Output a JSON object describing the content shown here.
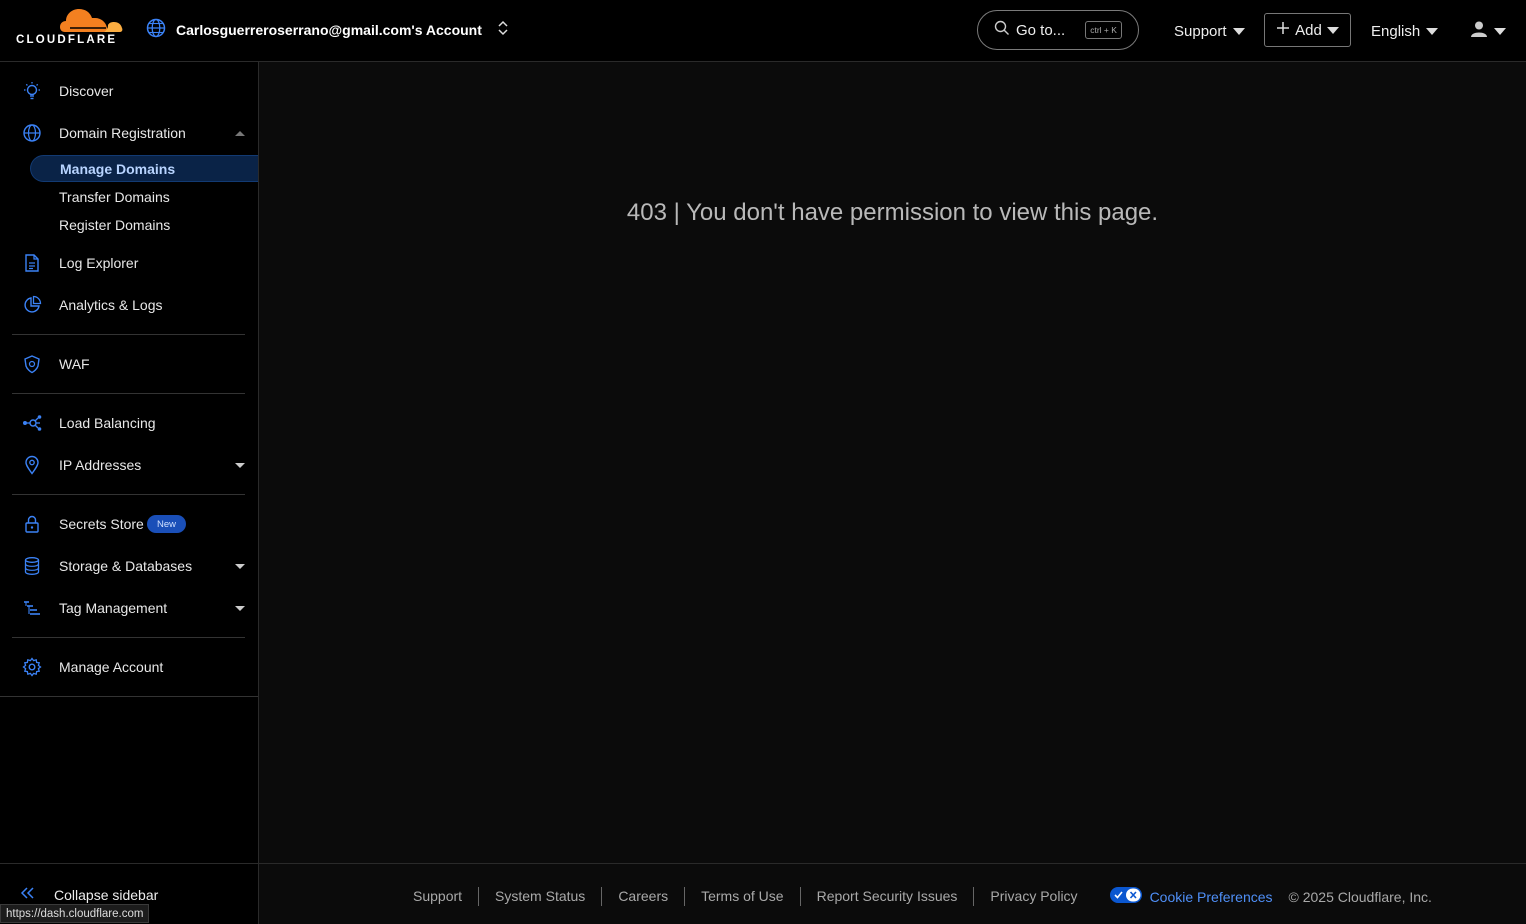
{
  "header": {
    "logo_text": "CLOUDFLARE",
    "account_name": "Carlosguerreroserrano@gmail.com's Account",
    "goto_label": "Go to...",
    "goto_shortcut": "ctrl + K",
    "support_label": "Support",
    "add_label": "Add",
    "language_label": "English"
  },
  "sidebar": {
    "items": [
      {
        "label": "Discover",
        "icon": "lightbulb-icon"
      },
      {
        "label": "Domain Registration",
        "icon": "globe-icon"
      },
      {
        "label": "Log Explorer",
        "icon": "document-icon"
      },
      {
        "label": "Analytics & Logs",
        "icon": "pie-chart-icon"
      },
      {
        "label": "WAF",
        "icon": "shield-icon"
      },
      {
        "label": "Load Balancing",
        "icon": "network-icon"
      },
      {
        "label": "IP Addresses",
        "icon": "location-pin-icon"
      },
      {
        "label": "Secrets Store",
        "icon": "lock-icon",
        "badge": "New"
      },
      {
        "label": "Storage & Databases",
        "icon": "database-icon"
      },
      {
        "label": "Tag Management",
        "icon": "tag-tree-icon"
      },
      {
        "label": "Manage Account",
        "icon": "gear-icon"
      }
    ],
    "sub_items": [
      {
        "label": "Manage Domains",
        "active": true
      },
      {
        "label": "Transfer Domains",
        "active": false
      },
      {
        "label": "Register Domains",
        "active": false
      }
    ],
    "collapse_label": "Collapse sidebar"
  },
  "main": {
    "error_message": "403 | You don't have permission to view this page."
  },
  "footer": {
    "links": [
      "Support",
      "System Status",
      "Careers",
      "Terms of Use",
      "Report Security Issues",
      "Privacy Policy"
    ],
    "cookie_label": "Cookie Preferences",
    "copyright": "© 2025 Cloudflare, Inc."
  },
  "status_url": "https://dash.cloudflare.com",
  "colors": {
    "accent": "#f38020",
    "link": "#4f8ff7",
    "icon": "#3b82f6"
  }
}
